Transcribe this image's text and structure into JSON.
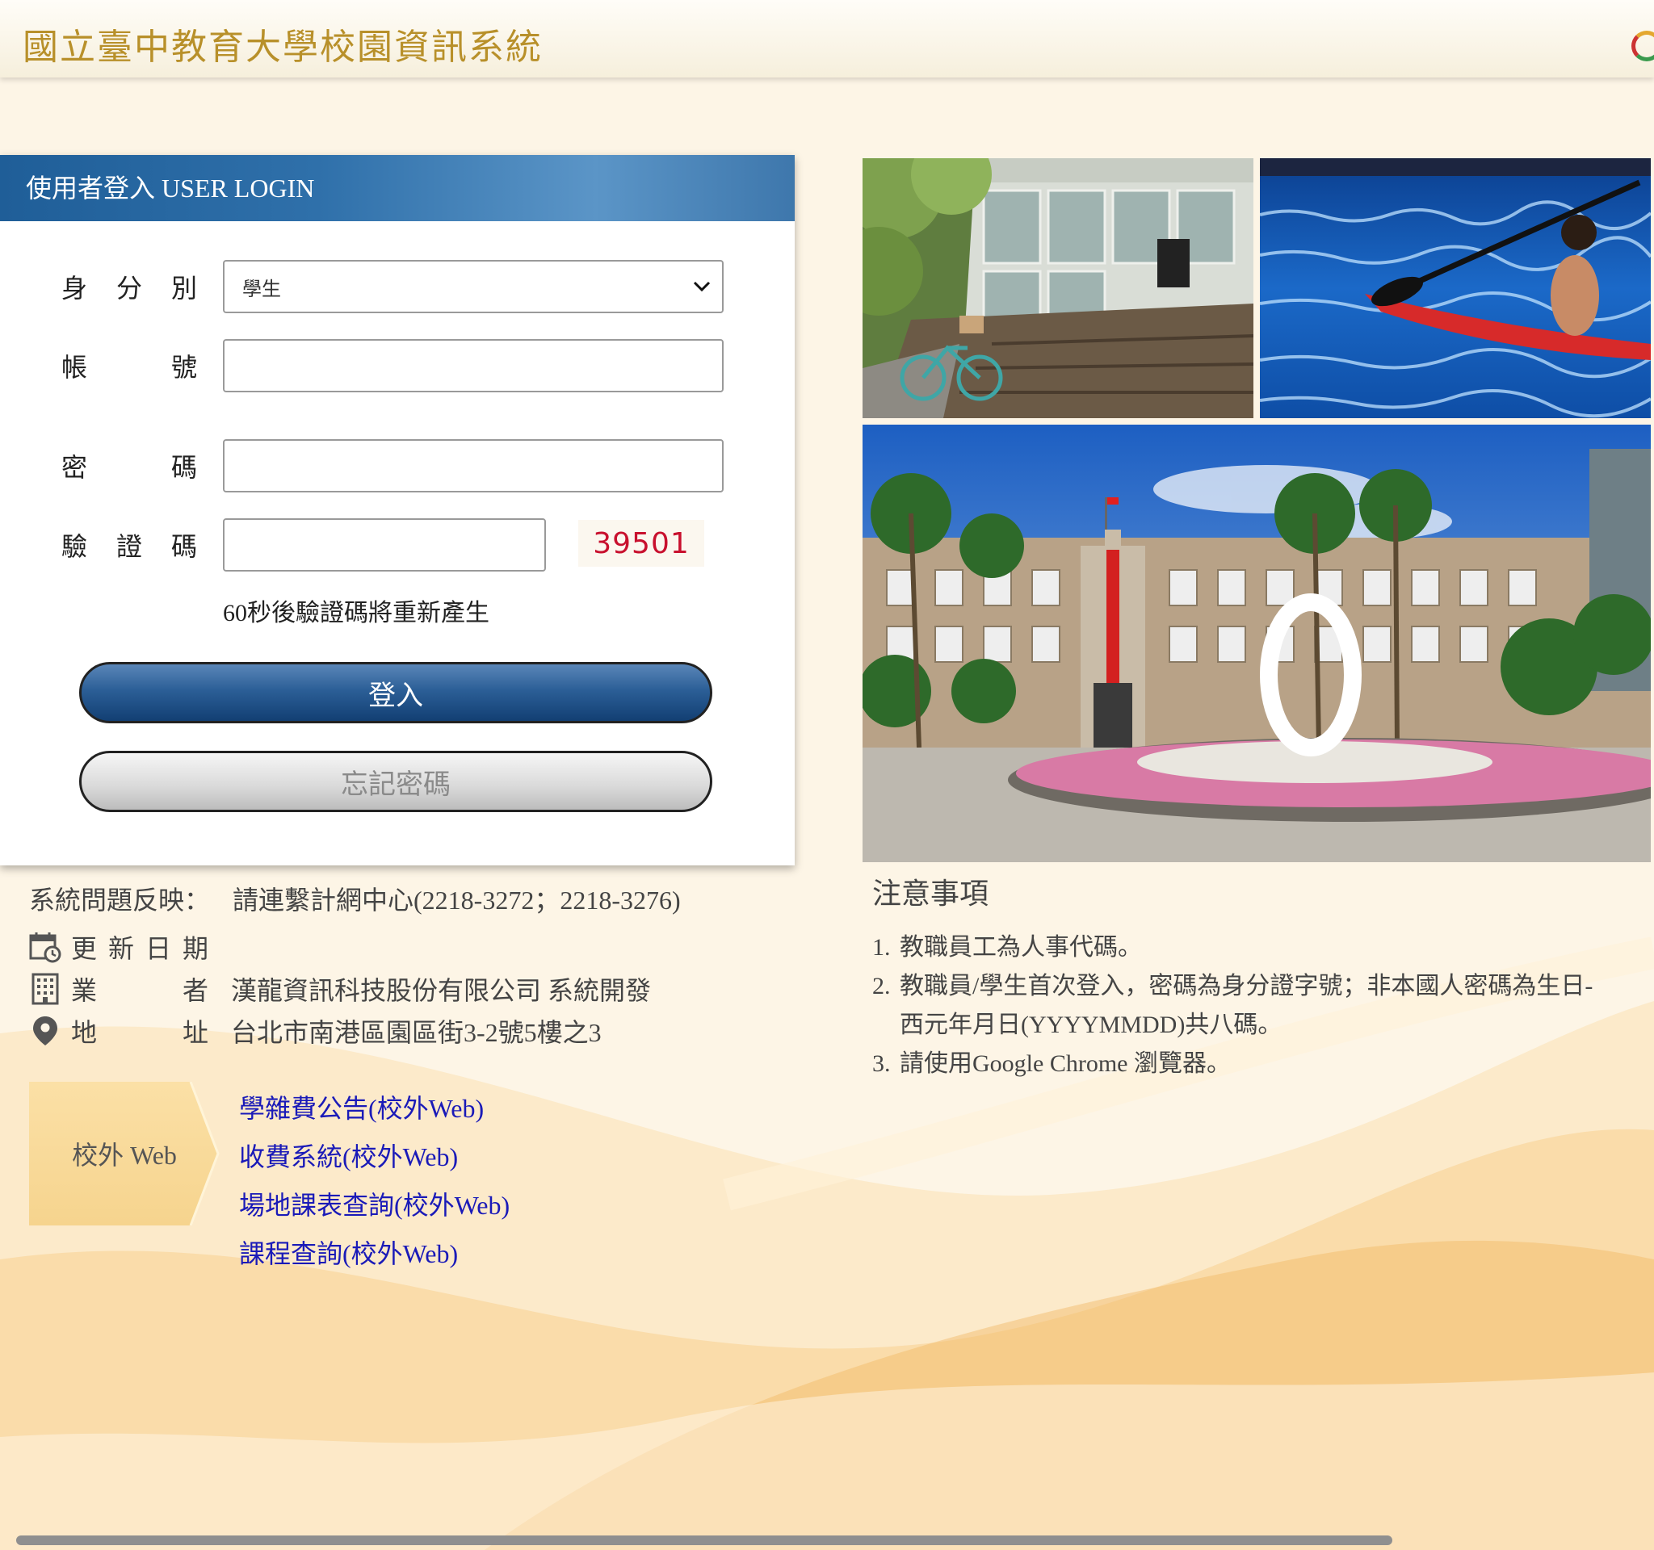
{
  "header": {
    "title": "國立臺中教育大學校園資訊系統"
  },
  "login": {
    "title": "使用者登入 USER LOGIN",
    "identity_label": [
      "身",
      "分",
      "別"
    ],
    "identity_value": "學生",
    "account_label": [
      "帳",
      "號"
    ],
    "account_value": "",
    "password_label": [
      "密",
      "碼"
    ],
    "password_value": "",
    "captcha_label": [
      "驗",
      "證",
      "碼"
    ],
    "captcha_value": "",
    "captcha_code": "39501",
    "captcha_note": "60秒後驗證碼將重新產生",
    "login_button": "登入",
    "forgot_button": "忘記密碼"
  },
  "info": {
    "feedback_label": "系統問題反映：",
    "feedback_value": "請連繫計網中心(2218-3272；2218-3276)",
    "update_label": [
      "更",
      "新",
      "日",
      "期"
    ],
    "vendor_label": [
      "業",
      "者"
    ],
    "vendor_value": "漢龍資訊科技股份有限公司 系統開發",
    "address_label": [
      "地",
      "址"
    ],
    "address_value": "台北市南港區園區街3-2號5樓之3"
  },
  "web": {
    "tag": "校外 Web",
    "links": [
      "學雜費公告(校外Web)",
      "收費系統(校外Web)",
      "場地課表查詢(校外Web)",
      "課程查詢(校外Web)"
    ]
  },
  "notes": {
    "title": "注意事項",
    "items": [
      {
        "num": "1.",
        "text": "教職員工為人事代碼。"
      },
      {
        "num": "2.",
        "text": "教職員/學生首次登入，密碼為身分證字號；非本國人密碼為生日- 西元年月日(YYYYMMDD)共八碼。"
      },
      {
        "num": "3.",
        "text": "請使用Google Chrome 瀏覽器。"
      }
    ]
  },
  "colors": {
    "header_title": "#b8902a",
    "login_header": "#2f70aa",
    "login_button": "#2c5f97",
    "link": "#1a1ab8",
    "captcha": "#c8102e",
    "background": "#fdf5e6"
  }
}
